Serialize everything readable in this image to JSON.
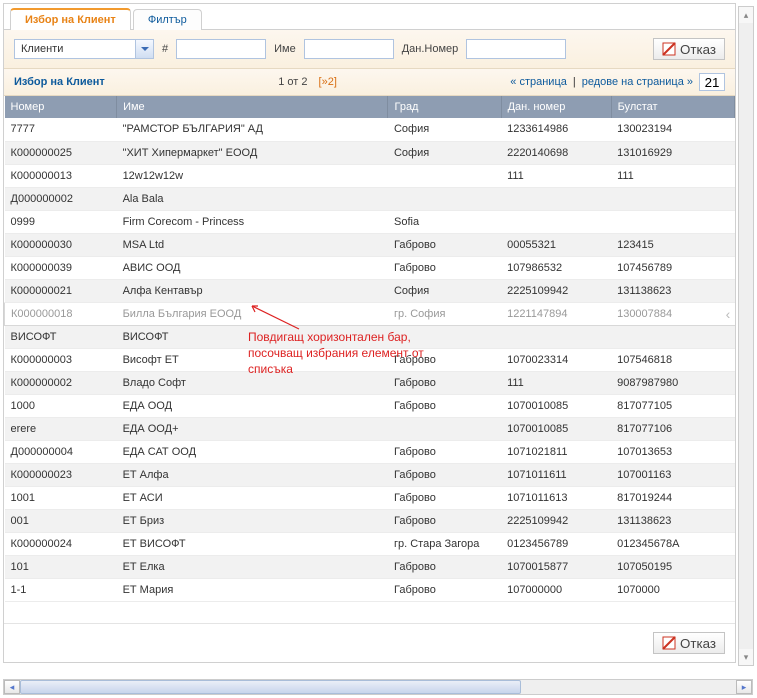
{
  "tabs": {
    "active": "Избор на Клиент",
    "filter": "Филтър"
  },
  "filter": {
    "dropdown_value": "Клиенти",
    "num_label": "#",
    "name_label": "Име",
    "dan_label": "Дан.Номер",
    "cancel_label": "Отказ"
  },
  "pager": {
    "title": "Избор на Клиент",
    "page_info": "1 от 2",
    "next": "[»2]",
    "prev_page": "« страница",
    "rows_label": "редове на страница »",
    "rows_value": "21"
  },
  "columns": {
    "nomer": "Номер",
    "ime": "Име",
    "grad": "Град",
    "dan": "Дан. номер",
    "bulstat": "Булстат"
  },
  "rows": [
    {
      "nomer": "7777",
      "ime": "\"РАМСТОР БЪЛГАРИЯ\" АД",
      "grad": "София",
      "dan": "1233614986",
      "bulstat": "130023194"
    },
    {
      "nomer": "К000000025",
      "ime": "\"ХИТ Хипермаркет\" ЕООД",
      "grad": "София",
      "dan": "2220140698",
      "bulstat": "131016929"
    },
    {
      "nomer": "К000000013",
      "ime": "12w12w12w",
      "grad": "",
      "dan": "111",
      "bulstat": "111"
    },
    {
      "nomer": "Д000000002",
      "ime": "Ala Bala",
      "grad": "",
      "dan": "",
      "bulstat": ""
    },
    {
      "nomer": "0999",
      "ime": "Firm Corecom - Princess",
      "grad": "Sofia",
      "dan": "",
      "bulstat": ""
    },
    {
      "nomer": "К000000030",
      "ime": "MSA Ltd",
      "grad": "Габрово",
      "dan": "00055321",
      "bulstat": "123415"
    },
    {
      "nomer": "К000000039",
      "ime": "АВИС ООД",
      "grad": "Габрово",
      "dan": "107986532",
      "bulstat": "107456789"
    },
    {
      "nomer": "К000000021",
      "ime": "Алфа Кентавър",
      "grad": "София",
      "dan": "2225109942",
      "bulstat": "131138623"
    },
    {
      "nomer": "К000000018",
      "ime": "Билла България ЕООД",
      "grad": "гр. София",
      "dan": "1221147894",
      "bulstat": "130007884",
      "selected": true
    },
    {
      "nomer": "ВИСОФТ",
      "ime": "ВИСОФТ",
      "grad": "",
      "dan": "",
      "bulstat": ""
    },
    {
      "nomer": "К000000003",
      "ime": "Висофт ЕТ",
      "grad": "Габрово",
      "dan": "1070023314",
      "bulstat": "107546818"
    },
    {
      "nomer": "К000000002",
      "ime": "Владо Софт",
      "grad": "Габрово",
      "dan": "111",
      "bulstat": "9087987980"
    },
    {
      "nomer": "1000",
      "ime": "ЕДА ООД",
      "grad": "Габрово",
      "dan": "1070010085",
      "bulstat": "817077105"
    },
    {
      "nomer": "erere",
      "ime": "ЕДА ООД+",
      "grad": "",
      "dan": "1070010085",
      "bulstat": "817077106"
    },
    {
      "nomer": "Д000000004",
      "ime": "ЕДА САТ ООД",
      "grad": "Габрово",
      "dan": "1071021811",
      "bulstat": "107013653"
    },
    {
      "nomer": "К000000023",
      "ime": "ЕТ Алфа",
      "grad": "Габрово",
      "dan": "1071011611",
      "bulstat": "107001163"
    },
    {
      "nomer": "1001",
      "ime": "ЕТ АСИ",
      "grad": "Габрово",
      "dan": "1071011613",
      "bulstat": "817019244"
    },
    {
      "nomer": "001",
      "ime": "ЕТ Бриз",
      "grad": "Габрово",
      "dan": "2225109942",
      "bulstat": "131138623"
    },
    {
      "nomer": "К000000024",
      "ime": "ЕТ ВИСОФТ",
      "grad": "гр. Стара Загора",
      "dan": "0123456789",
      "bulstat": "012345678A"
    },
    {
      "nomer": "101",
      "ime": "ЕТ Елка",
      "grad": "Габрово",
      "dan": "1070015877",
      "bulstat": "107050195"
    },
    {
      "nomer": "1-1",
      "ime": "ЕТ Мария",
      "grad": "Габрово",
      "dan": "107000000",
      "bulstat": "1070000"
    }
  ],
  "annotation": {
    "line1": "Повдигащ хоризонтален бар,",
    "line2": "посочващ избрания елемент от",
    "line3": "списъка"
  },
  "footer": {
    "cancel_label": "Отказ"
  }
}
